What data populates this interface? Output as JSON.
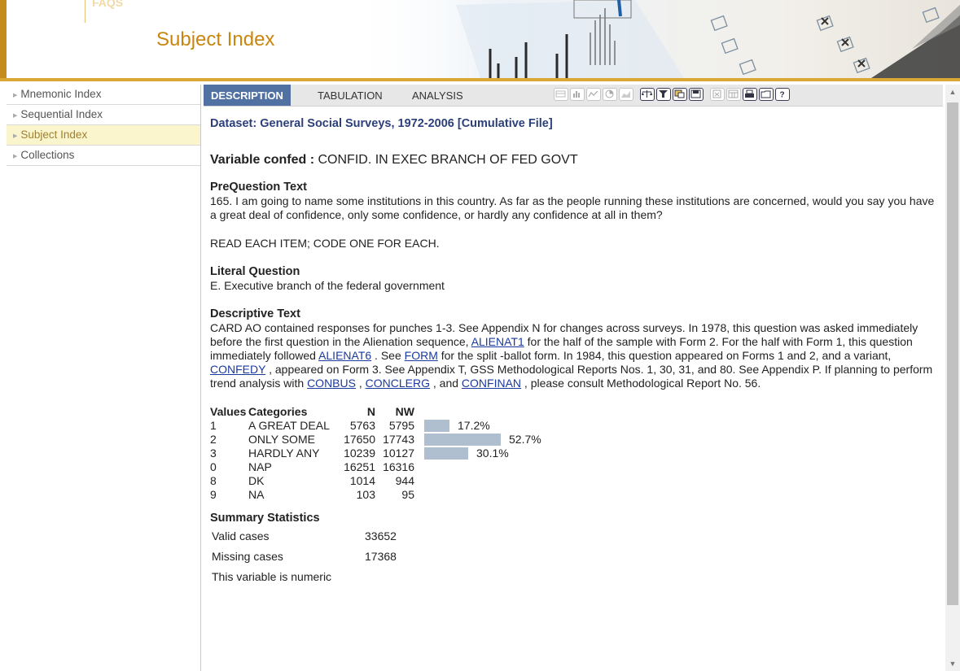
{
  "header": {
    "faqs": "FAQS",
    "title": "Subject Index"
  },
  "sidebar": {
    "items": [
      {
        "label": "Mnemonic Index"
      },
      {
        "label": "Sequential Index"
      },
      {
        "label": "Subject Index"
      },
      {
        "label": "Collections"
      }
    ]
  },
  "tabs": {
    "description": "DESCRIPTION",
    "tabulation": "TABULATION",
    "analysis": "ANALYSIS"
  },
  "dataset": "Dataset: General Social Surveys, 1972-2006 [Cumulative File]",
  "variable": {
    "prefix": "Variable confed :",
    "label": " CONFID. IN EXEC BRANCH OF FED GOVT"
  },
  "prequestion": {
    "heading": "PreQuestion Text",
    "text": "165. I am going to name some institutions in this country. As far as the people running these institutions are concerned, would you say you have a great deal of confidence, only some confidence, or hardly any confidence at all in them?",
    "instruction": "READ EACH ITEM; CODE ONE FOR EACH."
  },
  "literal": {
    "heading": "Literal Question",
    "text": "E. Executive branch of the federal government"
  },
  "descriptive": {
    "heading": "Descriptive Text",
    "t1": "CARD AO contained responses for punches 1-3. See Appendix N for changes across surveys. In 1978, this question was asked immediately before the first question in the Alienation sequence, ",
    "l1": "ALIENAT1",
    "t2": " for the half of the sample with Form 2. For the half with Form 1, this question immediately followed ",
    "l2": "ALIENAT6",
    "t3": " . See ",
    "l3": "FORM",
    "t4": " for the split -ballot form. In 1984, this question appeared on Forms 1 and 2, and a variant, ",
    "l4": "CONFEDY",
    "t5": " , appeared on Form 3. See Appendix T, GSS Methodological Reports Nos. 1, 30, 31, and 80. See Appendix P. If planning to perform trend analysis with ",
    "l5": "CONBUS",
    "t6": " , ",
    "l6": "CONCLERG",
    "t7": " , and ",
    "l7": "CONFINAN",
    "t8": " , please consult Methodological Report No. 56."
  },
  "values_table": {
    "headers": {
      "values": "Values",
      "categories": "Categories",
      "n": "N",
      "nw": "NW"
    },
    "rows": [
      {
        "value": "1",
        "category": "A GREAT DEAL",
        "n": "5763",
        "nw": "5795",
        "pct": 17.2,
        "pct_label": "17.2%"
      },
      {
        "value": "2",
        "category": "ONLY SOME",
        "n": "17650",
        "nw": "17743",
        "pct": 52.7,
        "pct_label": "52.7%"
      },
      {
        "value": "3",
        "category": "HARDLY ANY",
        "n": "10239",
        "nw": "10127",
        "pct": 30.1,
        "pct_label": "30.1%"
      },
      {
        "value": "0",
        "category": "NAP",
        "n": "16251",
        "nw": "16316",
        "pct": null,
        "pct_label": ""
      },
      {
        "value": "8",
        "category": "DK",
        "n": "1014",
        "nw": "944",
        "pct": null,
        "pct_label": ""
      },
      {
        "value": "9",
        "category": "NA",
        "n": "103",
        "nw": "95",
        "pct": null,
        "pct_label": ""
      }
    ]
  },
  "summary": {
    "heading": "Summary Statistics",
    "valid_label": "Valid cases",
    "valid_value": "33652",
    "missing_label": "Missing cases",
    "missing_value": "17368",
    "numeric_note": "This variable is numeric"
  },
  "colors": {
    "accent": "#d9a732",
    "tab_active": "#5171a3",
    "bar": "#b0bfcf",
    "link": "#1a3aa0"
  },
  "toolbar_icons": [
    "table-icon",
    "bar-chart-icon",
    "line-chart-icon",
    "pie-chart-icon",
    "area-chart-icon",
    "weight-icon",
    "filter-icon",
    "recode-icon",
    "save-icon",
    "export-icon",
    "calculator-icon",
    "print-icon",
    "folder-icon",
    "help-icon"
  ]
}
